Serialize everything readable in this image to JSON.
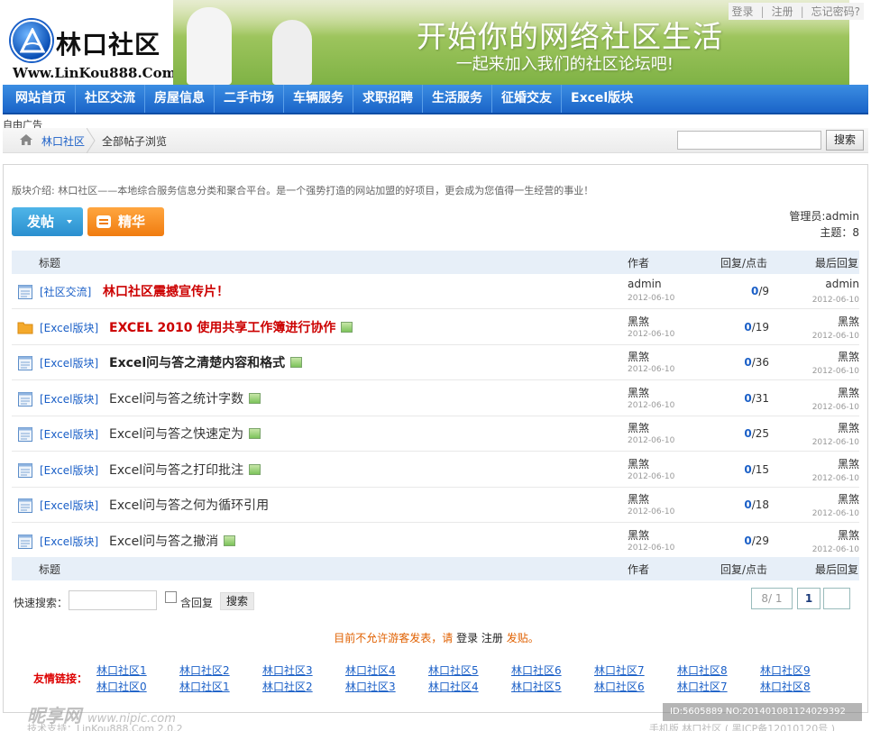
{
  "top_links": {
    "login": "登录",
    "register": "注册",
    "forgot": "忘记密码?"
  },
  "logo": {
    "name": "林口社区",
    "url": "Www.LinKou888.Com"
  },
  "banner": {
    "title": "开始你的网络社区生活",
    "subtitle": "一起来加入我们的社区论坛吧!"
  },
  "nav": [
    "网站首页",
    "社区交流",
    "房屋信息",
    "二手市场",
    "车辆服务",
    "求职招聘",
    "生活服务",
    "征婚交友",
    "Excel版块"
  ],
  "ad_label": "自由广告",
  "breadcrumb": {
    "home": "林口社区",
    "current": "全部帖子浏览"
  },
  "search": {
    "button": "搜索",
    "placeholder": ""
  },
  "intro": "版块介绍: 林口社区——本地综合服务信息分类和聚合平台。是一个强势打造的网站加盟的好项目，更会成为您值得一生经营的事业！",
  "buttons": {
    "post": "发帖",
    "digest": "精华"
  },
  "admin": {
    "moderator": "管理员:admin",
    "topics": "主题：8"
  },
  "table_head": {
    "title": "标题",
    "author": "作者",
    "stats": "回复/点击",
    "last": "最后回复"
  },
  "threads": [
    {
      "category": "[社区交流]",
      "title": "林口社区震撼宣传片！",
      "style": "red",
      "folder": false,
      "image": false,
      "author": "admin",
      "date": "2012-06-10",
      "replies": "0",
      "views": "/9",
      "last_user": "admin",
      "last_date": "2012-06-10"
    },
    {
      "category": "[Excel版块]",
      "title": "EXCEL 2010 使用共享工作簿进行协作",
      "style": "red",
      "folder": true,
      "image": true,
      "author": "黑煞",
      "date": "2012-06-10",
      "replies": "0",
      "views": "/19",
      "last_user": "黑煞",
      "last_date": "2012-06-10"
    },
    {
      "category": "[Excel版块]",
      "title": "Excel问与答之清楚内容和格式",
      "style": "bold",
      "folder": false,
      "image": true,
      "author": "黑煞",
      "date": "2012-06-10",
      "replies": "0",
      "views": "/36",
      "last_user": "黑煞",
      "last_date": "2012-06-10"
    },
    {
      "category": "[Excel版块]",
      "title": "Excel问与答之统计字数",
      "style": "normal",
      "folder": false,
      "image": true,
      "author": "黑煞",
      "date": "2012-06-10",
      "replies": "0",
      "views": "/31",
      "last_user": "黑煞",
      "last_date": "2012-06-10"
    },
    {
      "category": "[Excel版块]",
      "title": "Excel问与答之快速定为",
      "style": "normal",
      "folder": false,
      "image": true,
      "author": "黑煞",
      "date": "2012-06-10",
      "replies": "0",
      "views": "/25",
      "last_user": "黑煞",
      "last_date": "2012-06-10"
    },
    {
      "category": "[Excel版块]",
      "title": "Excel问与答之打印批注",
      "style": "normal",
      "folder": false,
      "image": true,
      "author": "黑煞",
      "date": "2012-06-10",
      "replies": "0",
      "views": "/15",
      "last_user": "黑煞",
      "last_date": "2012-06-10"
    },
    {
      "category": "[Excel版块]",
      "title": "Excel问与答之何为循环引用",
      "style": "normal",
      "folder": false,
      "image": false,
      "author": "黑煞",
      "date": "2012-06-10",
      "replies": "0",
      "views": "/18",
      "last_user": "黑煞",
      "last_date": "2012-06-10"
    },
    {
      "category": "[Excel版块]",
      "title": "Excel问与答之撤消",
      "style": "normal",
      "folder": false,
      "image": true,
      "author": "黑煞",
      "date": "2012-06-10",
      "replies": "0",
      "views": "/29",
      "last_user": "黑煞",
      "last_date": "2012-06-10"
    }
  ],
  "quick_search": {
    "label": "快速搜索：",
    "checkbox_label": "含回复",
    "button": "搜索"
  },
  "pager": {
    "info": "8/ 1",
    "current": "1"
  },
  "notice": {
    "part1": "目前不允许游客发表，请",
    "login": "登录",
    "register": "注册",
    "part2": "发贴。"
  },
  "friend_links": {
    "label": "友情链接：",
    "row1": [
      "林口社区1",
      "林口社区2",
      "林口社区3",
      "林口社区4",
      "林口社区5",
      "林口社区6",
      "林口社区7",
      "林口社区8",
      "林口社区9"
    ],
    "row2": [
      "林口社区0",
      "林口社区1",
      "林口社区2",
      "林口社区3",
      "林口社区4",
      "林口社区5",
      "林口社区6",
      "林口社区7",
      "林口社区8"
    ]
  },
  "footer": {
    "left": "技术支持：LinKou888.Com 2.0.2",
    "right": "手机版 林口社区 ( 黑ICP备12010120号 )"
  },
  "watermark": {
    "left": "昵享网",
    "left_url": "www.nipic.com",
    "right": "ID:5605889 NO:20140108112402939​2"
  },
  "colors": {
    "nav": "#1a64c8",
    "accent_red": "#cc0000",
    "link": "#1a5fc7",
    "post_button": "#2a8fcf",
    "digest_button": "#f07c10"
  }
}
